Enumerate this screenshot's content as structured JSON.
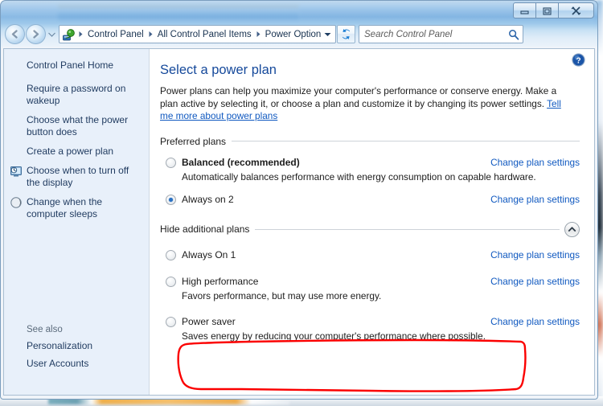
{
  "window": {
    "controls": {
      "minimize_label": "Minimize",
      "restore_label": "Restore",
      "close_label": "Close"
    }
  },
  "navigation": {
    "back_label": "Back",
    "forward_label": "Forward",
    "recent_pages_label": "Recent pages",
    "refresh_label": "Refresh",
    "address_icon": "power-plug-icon",
    "breadcrumbs": [
      "Control Panel",
      "All Control Panel Items",
      "Power Options"
    ],
    "breadcrumb_separator": "▸",
    "previous_locations_label": "Previous locations"
  },
  "search": {
    "placeholder": "Search Control Panel",
    "value": "",
    "icon": "search-icon"
  },
  "sidebar": {
    "home_label": "Control Panel Home",
    "items": [
      {
        "label": "Require a password on wakeup",
        "icon": null
      },
      {
        "label": "Choose what the power button does",
        "icon": null
      },
      {
        "label": "Create a power plan",
        "icon": null
      },
      {
        "label": "Choose when to turn off the display",
        "icon": "display-clock-icon"
      },
      {
        "label": "Change when the computer sleeps",
        "icon": "moon-sleep-icon"
      }
    ],
    "see_also": {
      "title": "See also",
      "items": [
        {
          "label": "Personalization"
        },
        {
          "label": "User Accounts"
        }
      ]
    }
  },
  "main": {
    "help_label": "Help",
    "heading": "Select a power plan",
    "intro_text": "Power plans can help you maximize your computer's performance or conserve energy. Make a plan active by selecting it, or choose a plan and customize it by changing its power settings. ",
    "intro_link": "Tell me more about power plans",
    "preferred_group": {
      "title": "Preferred plans"
    },
    "additional_group": {
      "title": "Hide additional plans",
      "collapse_icon": "chevron-up-icon"
    },
    "change_link_label": "Change plan settings",
    "preferred_plans": [
      {
        "name": "Balanced (recommended)",
        "selected": false,
        "bold": true,
        "description": "Automatically balances performance with energy consumption on capable hardware.",
        "link": "Change plan settings"
      },
      {
        "name": "Always on 2",
        "selected": true,
        "bold": false,
        "description": "",
        "link": "Change plan settings"
      }
    ],
    "additional_plans": [
      {
        "name": "Always On 1",
        "selected": false,
        "bold": false,
        "description": "",
        "link": "Change plan settings"
      },
      {
        "name": "High performance",
        "selected": false,
        "bold": false,
        "description": "Favors performance, but may use more energy.",
        "link": "Change plan settings"
      },
      {
        "name": "Power saver",
        "selected": false,
        "bold": false,
        "description": "Saves energy by reducing your computer's performance where possible.",
        "link": "Change plan settings"
      }
    ]
  },
  "annotation": {
    "type": "hand-drawn-rounded-rectangle",
    "color": "#fb0000",
    "stroke_width": 2.4
  },
  "colors": {
    "heading": "#15499b",
    "link": "#1059c0",
    "sidebar_bg": "#e8f0fa",
    "radio_dot": "#2a72c4",
    "annotation_red": "#fb0000"
  }
}
